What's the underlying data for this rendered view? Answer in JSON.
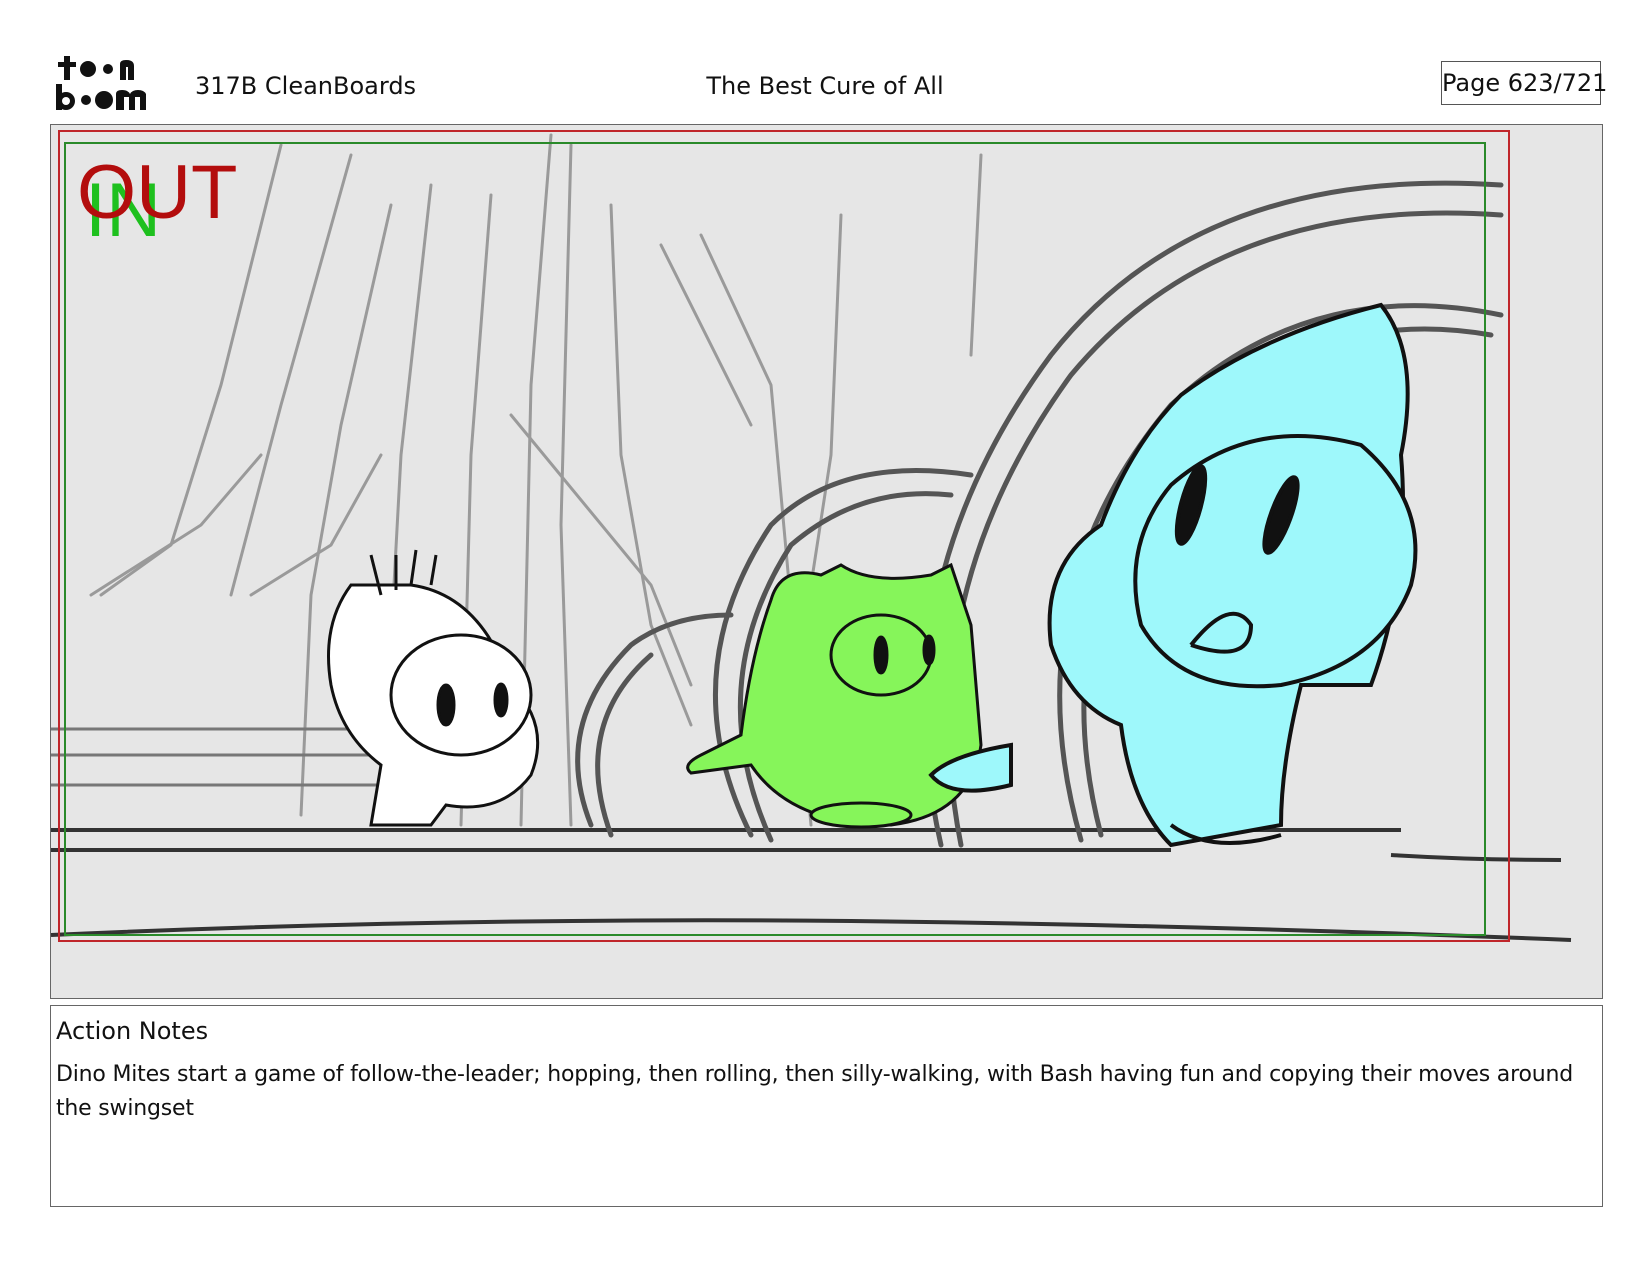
{
  "header": {
    "logo_label": "toon boom",
    "project": "317B  CleanBoards",
    "title": "The Best Cure of All",
    "page": "Page 623/721"
  },
  "panel": {
    "in_label": "IN",
    "out_label": "OUT",
    "scene": "sketch of swingset with three dino characters walking"
  },
  "notes": {
    "heading": "Action Notes",
    "body": "Dino Mites start a game of follow-the-leader; hopping, then rolling, then silly-walking, with Bash having fun and copying their moves around the swingset"
  },
  "colors": {
    "in_label": "#1ec01e",
    "out_label": "#b30d0d",
    "green_character": "#86f55a",
    "blue_character": "#9ef8fb",
    "background": "#e6e6e6"
  }
}
